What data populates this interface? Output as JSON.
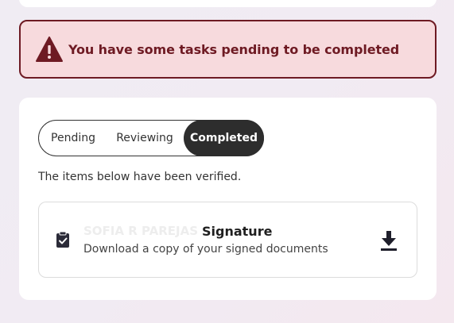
{
  "alert": {
    "icon": "warning-triangle-icon",
    "message": "You have some tasks pending to be completed",
    "color": "#6e1a23",
    "background": "#f7dadd"
  },
  "tabs": [
    {
      "label": "Pending",
      "active": false
    },
    {
      "label": "Reviewing",
      "active": false
    },
    {
      "label": "Completed",
      "active": true
    }
  ],
  "verified_message": "The items below have been verified.",
  "documents": [
    {
      "icon": "clipboard-check-icon",
      "signer_name": "SOFIA R PAREJAS",
      "title": "Signature",
      "subtitle": "Download a copy of your signed documents",
      "action_icon": "download-icon"
    }
  ]
}
